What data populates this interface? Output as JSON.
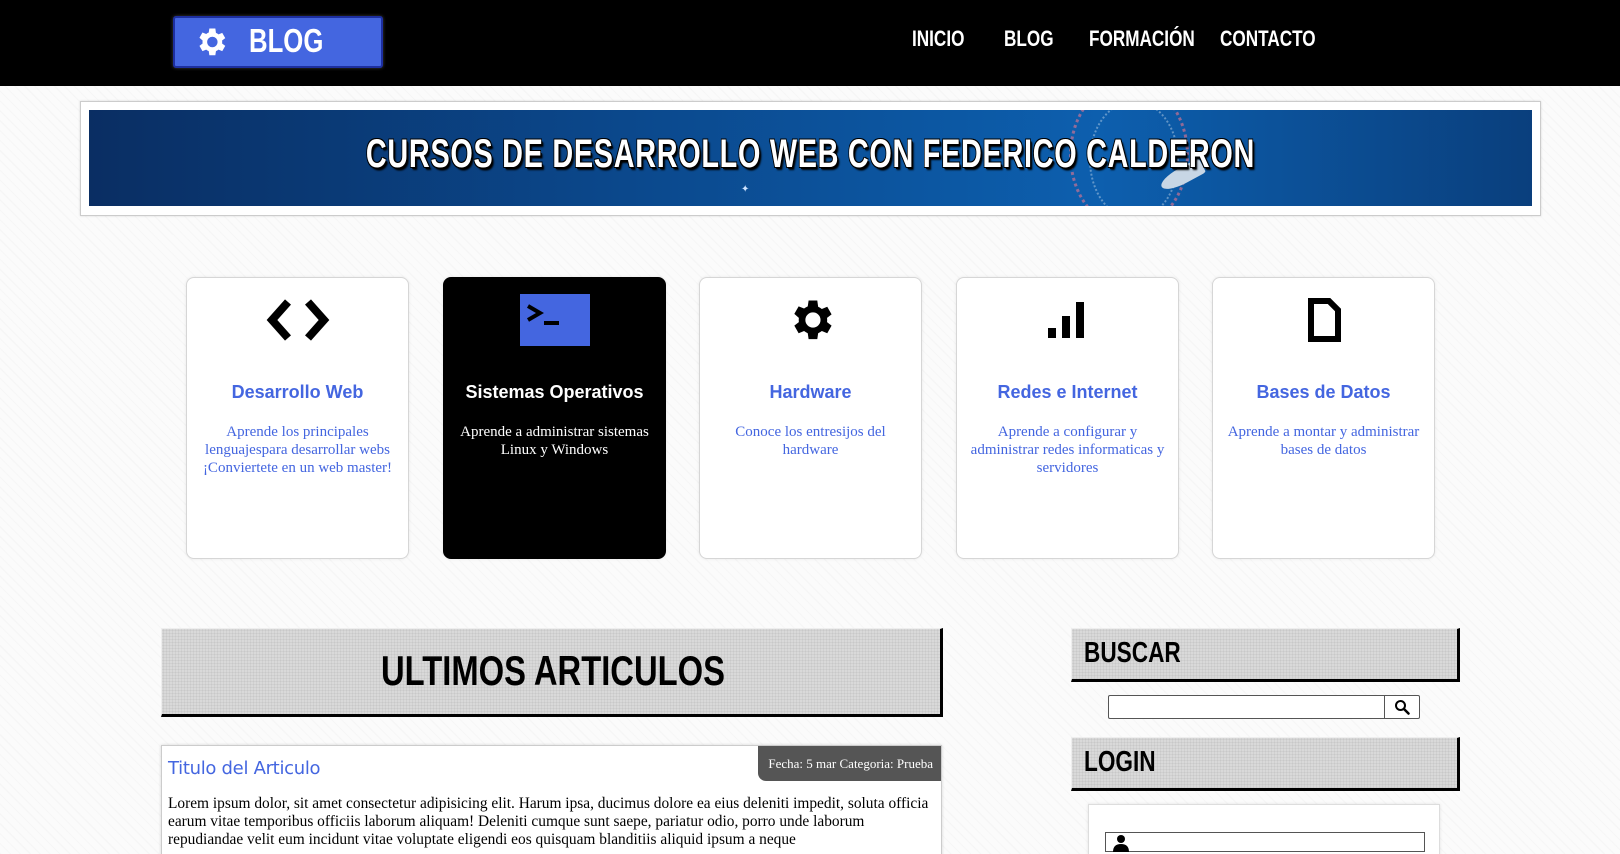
{
  "header": {
    "logo_text": "BLOG",
    "nav": [
      {
        "label": "INICIO"
      },
      {
        "label": "BLOG"
      },
      {
        "label": "FORMACIÓN"
      },
      {
        "label": "CONTACTO"
      }
    ]
  },
  "banner": {
    "title": "CURSOS DE DESARROLLO WEB CON FEDERICO CALDERON"
  },
  "categories": [
    {
      "icon": "code-icon",
      "title": "Desarrollo Web",
      "description": "Aprende los principales lenguajespara desarrollar webs ¡Conviertete en un web master!"
    },
    {
      "icon": "terminal-icon",
      "title": "Sistemas Operativos",
      "description": "Aprende a administrar sistemas Linux y Windows"
    },
    {
      "icon": "gear-icon",
      "title": "Hardware",
      "description": "Conoce los entresijos del hardware"
    },
    {
      "icon": "signal-bars-icon",
      "title": "Redes e Internet",
      "description": "Aprende a configurar y administrar redes informaticas y servidores"
    },
    {
      "icon": "document-icon",
      "title": "Bases de Datos",
      "description": "Aprende a montar y administrar bases de datos"
    }
  ],
  "articles_section": {
    "heading": "ULTIMOS ARTICULOS",
    "article": {
      "title": "Titulo del Articulo",
      "meta": "Fecha: 5 mar Categoria: Prueba",
      "body": "Lorem ipsum dolor, sit amet consectetur adipisicing elit. Harum ipsa, ducimus dolore ea eius deleniti impedit, soluta officia earum vitae temporibus officiis laborum aliquam! Deleniti cumque sunt saepe, pariatur odio, porro unde laborum repudiandae velit eum incidunt vitae voluptate eligendi eos quisquam blanditiis aliquid ipsum a neque"
    }
  },
  "sidebar": {
    "search_heading": "BUSCAR",
    "search_value": "",
    "login_heading": "LOGIN",
    "username_value": ""
  },
  "colors": {
    "accent": "#4466e0",
    "header_bg": "#000000",
    "meta_bg": "#555555"
  }
}
